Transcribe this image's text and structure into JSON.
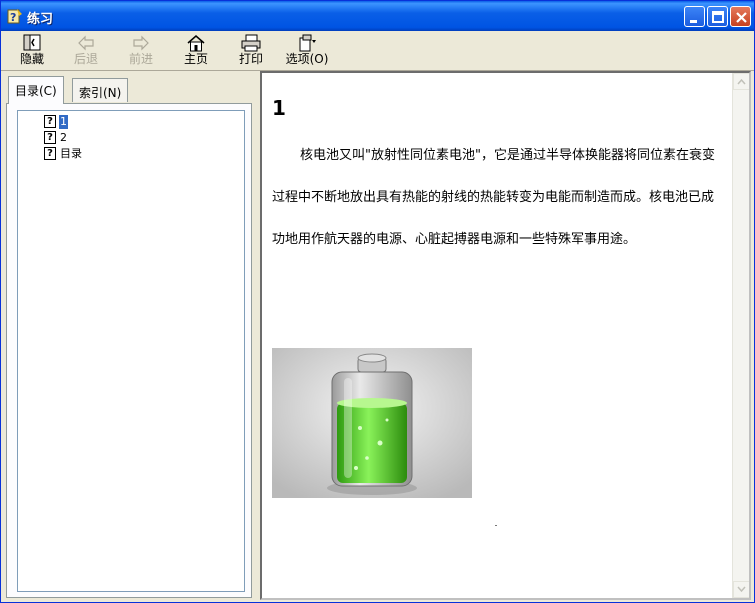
{
  "window": {
    "title": "练习"
  },
  "toolbar": {
    "hide": "隐藏",
    "back": "后退",
    "forward": "前进",
    "home": "主页",
    "print": "打印",
    "options": "选项(O)"
  },
  "tabs": [
    {
      "label": "目录(C)",
      "active": true
    },
    {
      "label": "索引(N)",
      "active": false
    }
  ],
  "tree": {
    "items": [
      {
        "label": "1",
        "selected": true
      },
      {
        "label": "2",
        "selected": false
      },
      {
        "label": "目录",
        "selected": false
      }
    ]
  },
  "content": {
    "heading": "1",
    "paragraph": "核电池又叫\"放射性同位素电池\"，它是通过半导体换能器将同位素在衰变过程中不断地放出具有热能的射线的热能转变为电能而制造而成。核电池已成功地用作航天器的电源、心脏起搏器电源和一些特殊军事用途。",
    "image_icon": "battery-image"
  },
  "colors": {
    "titlebar": "#0054e3",
    "selection": "#316ac5",
    "battery_green": "#5fd12b"
  }
}
